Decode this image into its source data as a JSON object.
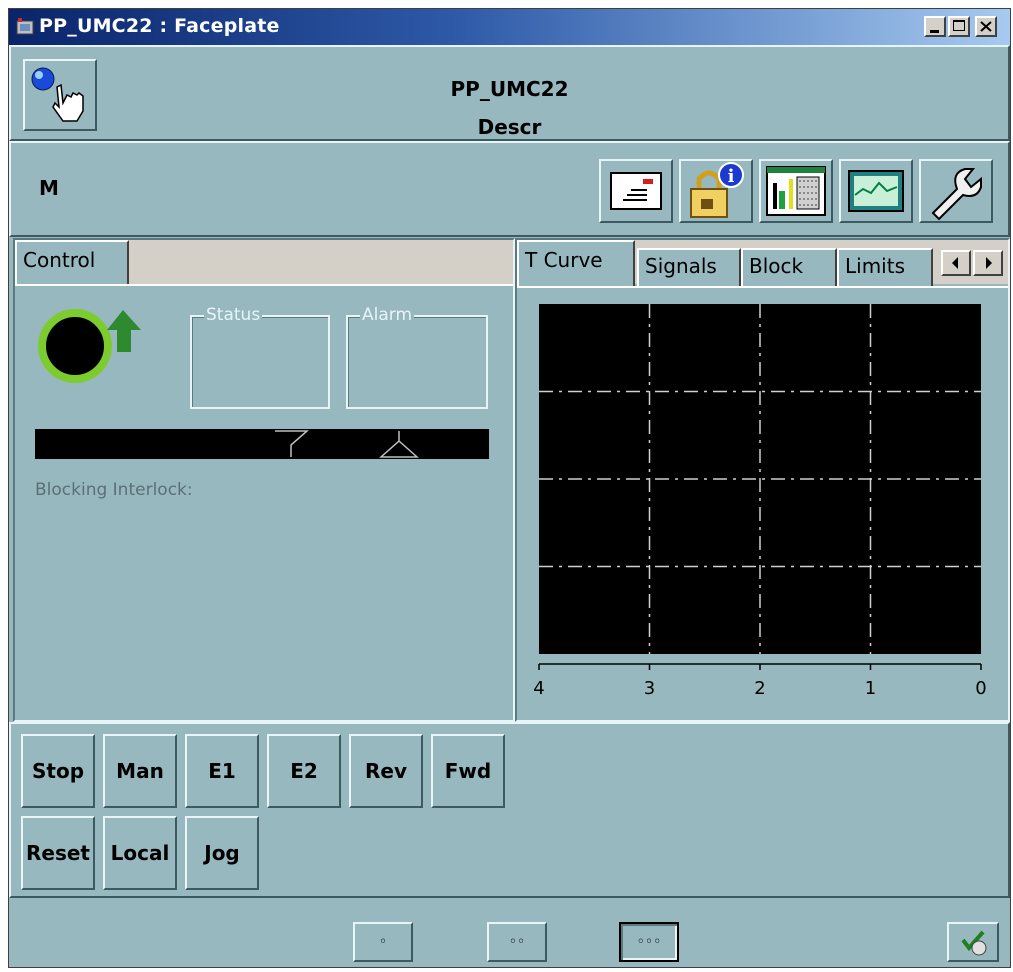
{
  "window": {
    "title": "PP_UMC22 : Faceplate",
    "controls": {
      "minimize": "_",
      "maximize": "□",
      "close": "×"
    }
  },
  "header": {
    "name": "PP_UMC22",
    "description": "Descr",
    "mode": "M"
  },
  "toolbar": {
    "icons": [
      "message-icon",
      "lock-info-icon",
      "signals-overview-icon",
      "trend-icon",
      "wrench-icon"
    ]
  },
  "left_panel": {
    "tab_label": "Control",
    "status_label": "Status",
    "alarm_label": "Alarm",
    "interlock_label": "Blocking Interlock:"
  },
  "right_panel": {
    "tabs": [
      "T Curve",
      "Signals",
      "Block",
      "Limits"
    ],
    "scroll_left": "◀",
    "scroll_right": "▶"
  },
  "chart_data": {
    "type": "line",
    "title": "",
    "xlabel": "",
    "ylabel": "",
    "x_ticks": [
      "4",
      "3",
      "2",
      "1",
      "0"
    ],
    "xlim": [
      4,
      0
    ],
    "grid": true,
    "series": []
  },
  "commands": {
    "row1": [
      "Stop",
      "Man",
      "E1",
      "E2",
      "Rev",
      "Fwd"
    ],
    "row2": [
      "Reset",
      "Local",
      "Jog"
    ]
  },
  "footer": {
    "nav_small": "◦",
    "nav_medium": "◦◦",
    "nav_large": "◦◦◦"
  },
  "colors": {
    "panel": "#98b8bf",
    "motor_ring": "#7ccc30",
    "arrow": "#2e8a2e",
    "trend_bg": "#000000"
  }
}
